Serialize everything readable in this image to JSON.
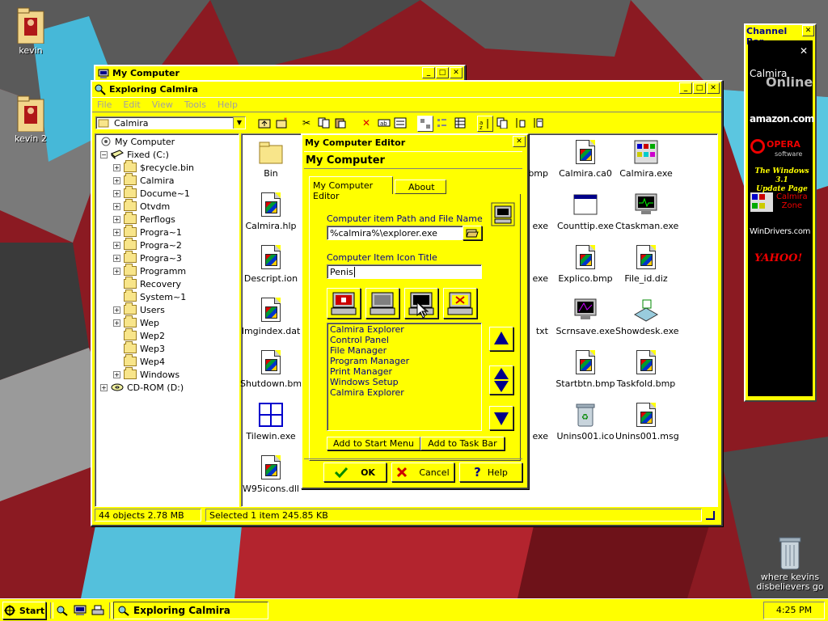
{
  "desktop": {
    "icons": [
      {
        "label": "kevin",
        "icon": "folder-kevin-icon"
      },
      {
        "label": "kevin 2",
        "icon": "folder-kevin-icon"
      },
      {
        "label": "where kevins disbelievers go",
        "icon": "recycle-bin-icon"
      }
    ]
  },
  "window_back": {
    "title": "My Computer"
  },
  "explorer": {
    "title": "Exploring Calmira",
    "menu": [
      "File",
      "Edit",
      "View",
      "Tools",
      "Help"
    ],
    "address": "Calmira",
    "tree": [
      {
        "label": "My Computer"
      },
      {
        "label": "Fixed (C:)"
      },
      {
        "label": "$recycle.bin"
      },
      {
        "label": "Calmira"
      },
      {
        "label": "Docume~1"
      },
      {
        "label": "Otvdm"
      },
      {
        "label": "Perflogs"
      },
      {
        "label": "Progra~1"
      },
      {
        "label": "Progra~2"
      },
      {
        "label": "Progra~3"
      },
      {
        "label": "Programm"
      },
      {
        "label": "Recovery"
      },
      {
        "label": "System~1"
      },
      {
        "label": "Users"
      },
      {
        "label": "Wep"
      },
      {
        "label": "Wep2"
      },
      {
        "label": "Wep3"
      },
      {
        "label": "Wep4"
      },
      {
        "label": "Windows"
      },
      {
        "label": "CD-ROM (D:)"
      }
    ],
    "files": [
      {
        "label": "Bin"
      },
      {
        "label": "bmp"
      },
      {
        "label": "Calmira.ca0"
      },
      {
        "label": "Calmira.exe"
      },
      {
        "label": "Calmira.hlp"
      },
      {
        "label": "exe"
      },
      {
        "label": "Counttip.exe"
      },
      {
        "label": "Ctaskman.exe"
      },
      {
        "label": "Descript.ion"
      },
      {
        "label": "exe"
      },
      {
        "label": "Explico.bmp"
      },
      {
        "label": "File_id.diz"
      },
      {
        "label": "Imgindex.dat"
      },
      {
        "label": "txt"
      },
      {
        "label": "Scrnsave.exe"
      },
      {
        "label": "Showdesk.exe"
      },
      {
        "label": "Shutdown.bmp"
      },
      {
        "label": "Startbtn.bmp"
      },
      {
        "label": "Taskfold.bmp"
      },
      {
        "label": "Tilewin.exe"
      },
      {
        "label": "exe"
      },
      {
        "label": "Unins001.ico"
      },
      {
        "label": "Unins001.msg"
      },
      {
        "label": "W95icons.dll"
      }
    ],
    "status_left": "44 objects  2.78 MB",
    "status_right": "Selected 1 item  245.85 KB"
  },
  "dialog": {
    "title": "My Computer Editor",
    "header": "My Computer",
    "tabs": [
      "My Computer Editor",
      "About"
    ],
    "path_label": "Computer item Path and File Name",
    "path_value": "%calmira%\\explorer.exe",
    "title_label": "Computer Item Icon Title",
    "title_value": "Penis",
    "list": [
      "Calmira Explorer",
      "Control Panel",
      "File Manager",
      "Program Manager",
      "Print Manager",
      "Windows Setup",
      "Calmira Explorer"
    ],
    "add_start": "Add to Start Menu",
    "add_task": "Add to Task Bar",
    "ok": "OK",
    "cancel": "Cancel",
    "help": "Help"
  },
  "channel_bar": {
    "title": "Channel Bar",
    "channels": [
      {
        "main": "Calmira",
        "sub": "Online"
      },
      {
        "main": "amazon.com"
      },
      {
        "main": "OPERA",
        "sub": "software"
      },
      {
        "main": "The Windows 3.1",
        "sub": "Update Page"
      },
      {
        "main": "Calmira",
        "sub": "Zone"
      },
      {
        "main": "WinDrivers.com"
      },
      {
        "main": "YAHOO!"
      }
    ]
  },
  "taskbar": {
    "start": "Start",
    "task": "Exploring Calmira",
    "clock": "4:25 PM"
  },
  "colors": {
    "theme_yellow": "#ffff00",
    "title_active": "#ffff00",
    "list_text": "#00008b"
  }
}
